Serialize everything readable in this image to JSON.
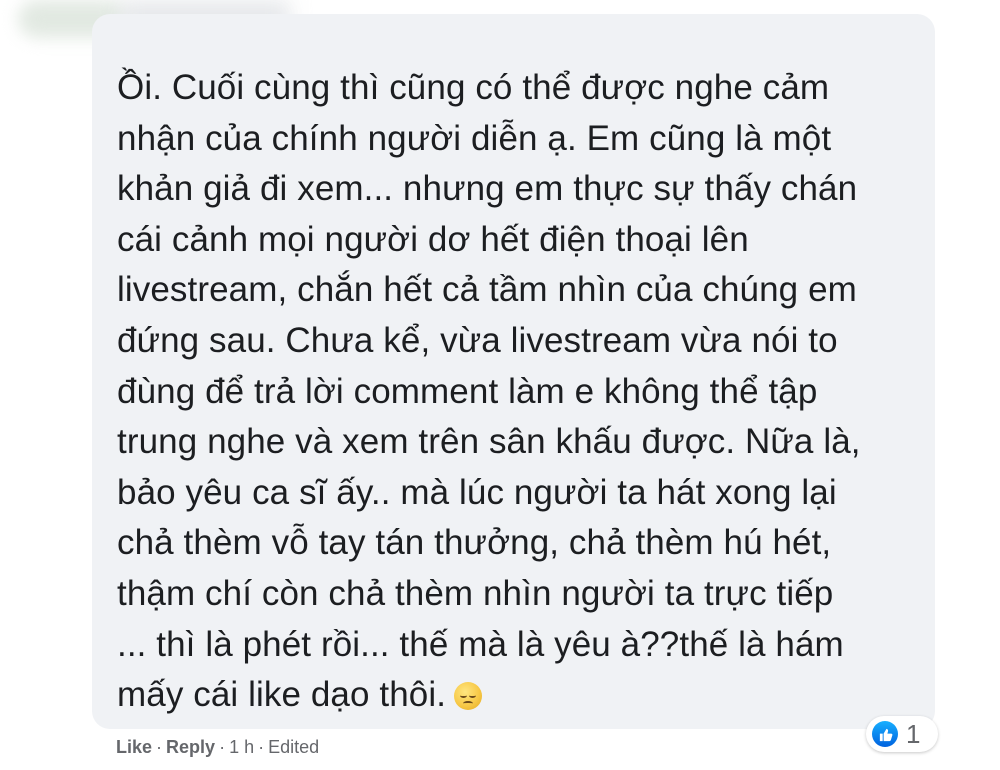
{
  "comment": {
    "lines": [
      "Ồi. Cuối cùng thì cũng có thể được nghe cảm",
      "nhận của chính người diễn ạ. Em cũng là một",
      "khản giả đi xem... nhưng em thực sự thấy chán",
      "cái cảnh mọi người dơ hết điện thoại lên",
      "livestream, chắn hết cả tầm nhìn của chúng em",
      "đứng sau. Chưa kể, vừa livestream vừa nói to",
      "đùng để trả lời comment làm e không thể tập",
      "trung nghe và xem trên sân khấu được. Nữa là,",
      "bảo yêu ca sĩ ấy.. mà lúc người ta hát xong lại",
      "chả thèm vỗ tay tán thưởng, chả thèm hú hét,",
      "thậm chí còn chả thèm nhìn người ta trực tiếp",
      "... thì là phét rồi... thế mà là yêu à??thế là hám",
      "mấy cái like dạo thôi."
    ],
    "emoji": "pensive-face-icon"
  },
  "reactions": {
    "icon": "like-icon",
    "count": "1",
    "color": "#1877f2"
  },
  "actions": {
    "like_label": "Like",
    "reply_label": "Reply",
    "time": "1 h",
    "edited": "Edited",
    "dot": "·"
  },
  "colors": {
    "bubble": "#f0f2f5",
    "text": "#1c1e21",
    "meta": "#65676b"
  }
}
